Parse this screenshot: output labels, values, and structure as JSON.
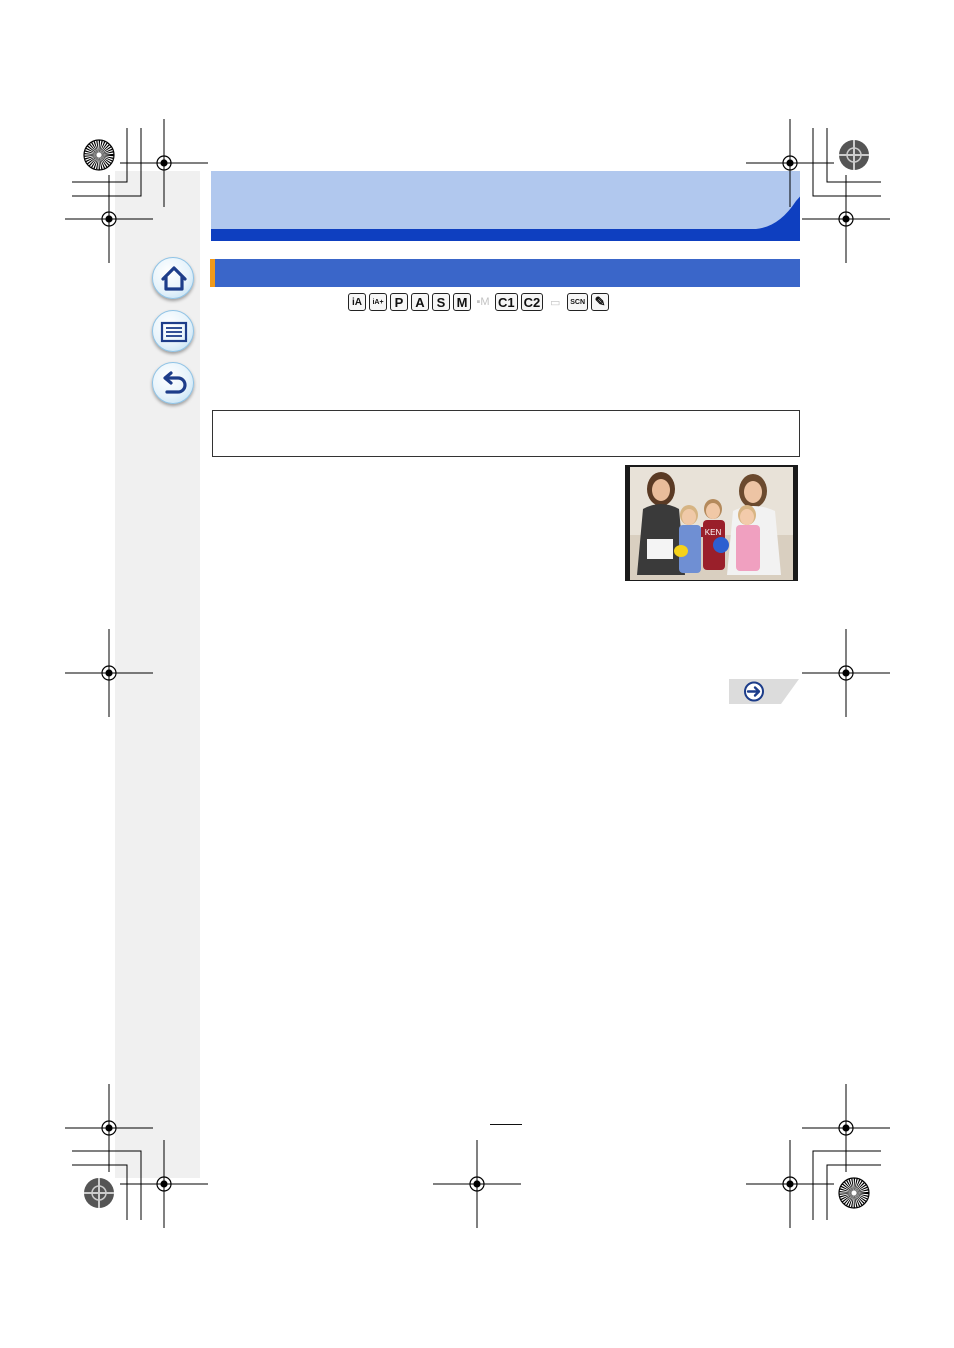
{
  "page": {
    "number": ""
  },
  "nav": {
    "home_icon": "home-icon",
    "contents_icon": "contents-list-icon",
    "back_icon": "back-arrow-icon",
    "next_icon": "next-page-arrow-icon"
  },
  "modes": [
    {
      "id": "ia",
      "label": "iA",
      "style": "small"
    },
    {
      "id": "ia-plus",
      "label": "iA+",
      "style": "tiny"
    },
    {
      "id": "p",
      "label": "P",
      "style": ""
    },
    {
      "id": "a",
      "label": "A",
      "style": ""
    },
    {
      "id": "s",
      "label": "S",
      "style": ""
    },
    {
      "id": "m",
      "label": "M",
      "style": ""
    },
    {
      "id": "creative-video",
      "label": "▪M",
      "style": "dim"
    },
    {
      "id": "c1",
      "label": "C1",
      "style": ""
    },
    {
      "id": "c2",
      "label": "C2",
      "style": ""
    },
    {
      "id": "panorama",
      "label": "▭",
      "style": "dim"
    },
    {
      "id": "scn",
      "label": "SCN",
      "style": "tiny"
    },
    {
      "id": "creative-control",
      "label": "✎",
      "style": ""
    }
  ],
  "photo": {
    "label": "KEN"
  },
  "colors": {
    "header_light": "#b1c8ee",
    "header_dark": "#0e3fc0",
    "section_bar": "#3a66c9",
    "section_accent": "#f09a1a",
    "sidebar": "#f0f0f0",
    "nav_icon": "#1d3d8a"
  }
}
